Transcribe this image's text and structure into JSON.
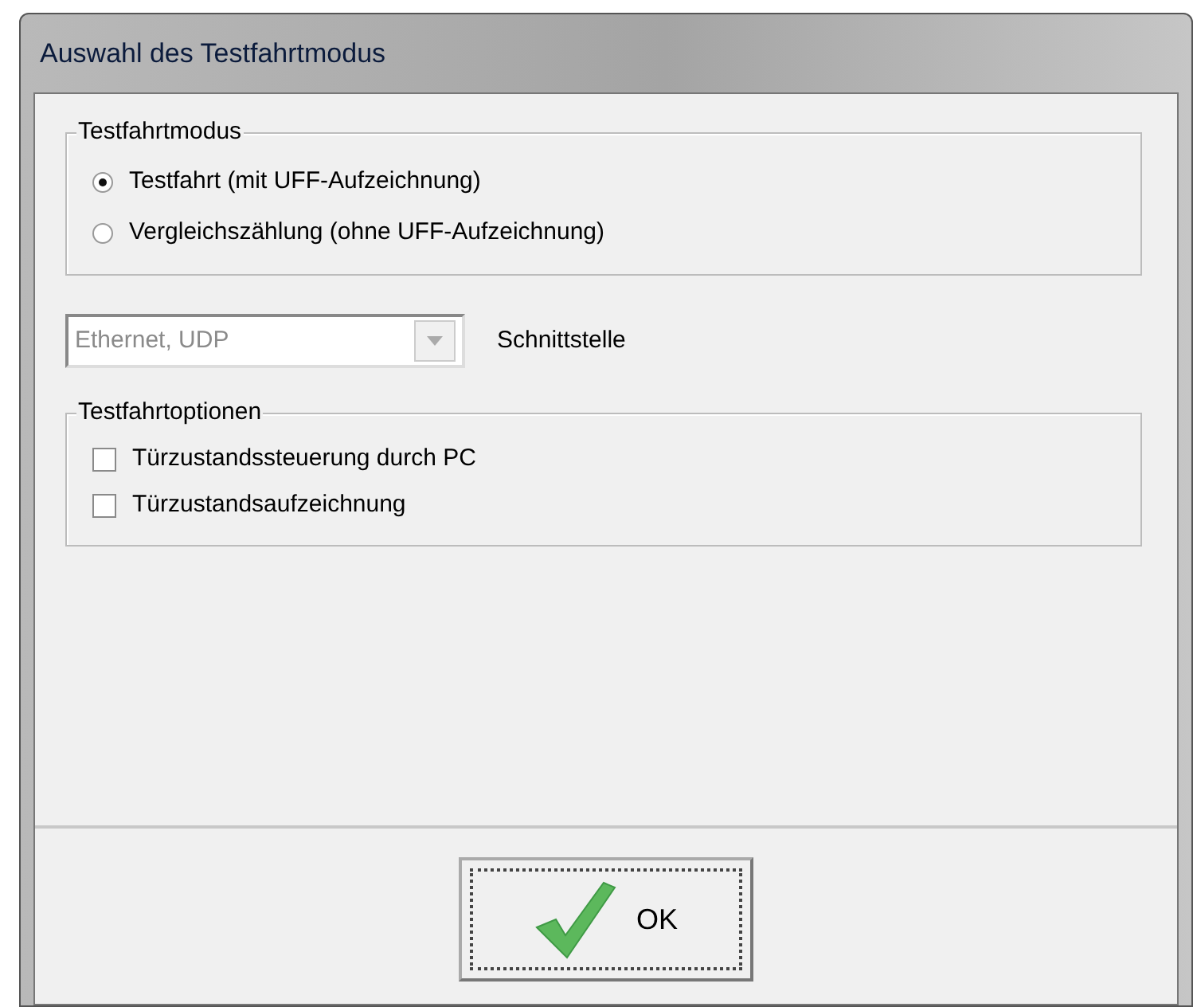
{
  "window": {
    "title": "Auswahl des Testfahrtmodus"
  },
  "mode_group": {
    "title": "Testfahrtmodus",
    "options": [
      {
        "label": "Testfahrt (mit UFF-Aufzeichnung)",
        "selected": true
      },
      {
        "label": "Vergleichszählung (ohne UFF-Aufzeichnung)",
        "selected": false
      }
    ]
  },
  "interface": {
    "value": "Ethernet, UDP",
    "disabled": true,
    "label": "Schnittstelle"
  },
  "options_group": {
    "title": "Testfahrtoptionen",
    "options": [
      {
        "label": "Türzustandssteuerung durch PC",
        "checked": false
      },
      {
        "label": "Türzustandsaufzeichnung",
        "checked": false
      }
    ]
  },
  "buttons": [
    {
      "label": "OK"
    }
  ]
}
